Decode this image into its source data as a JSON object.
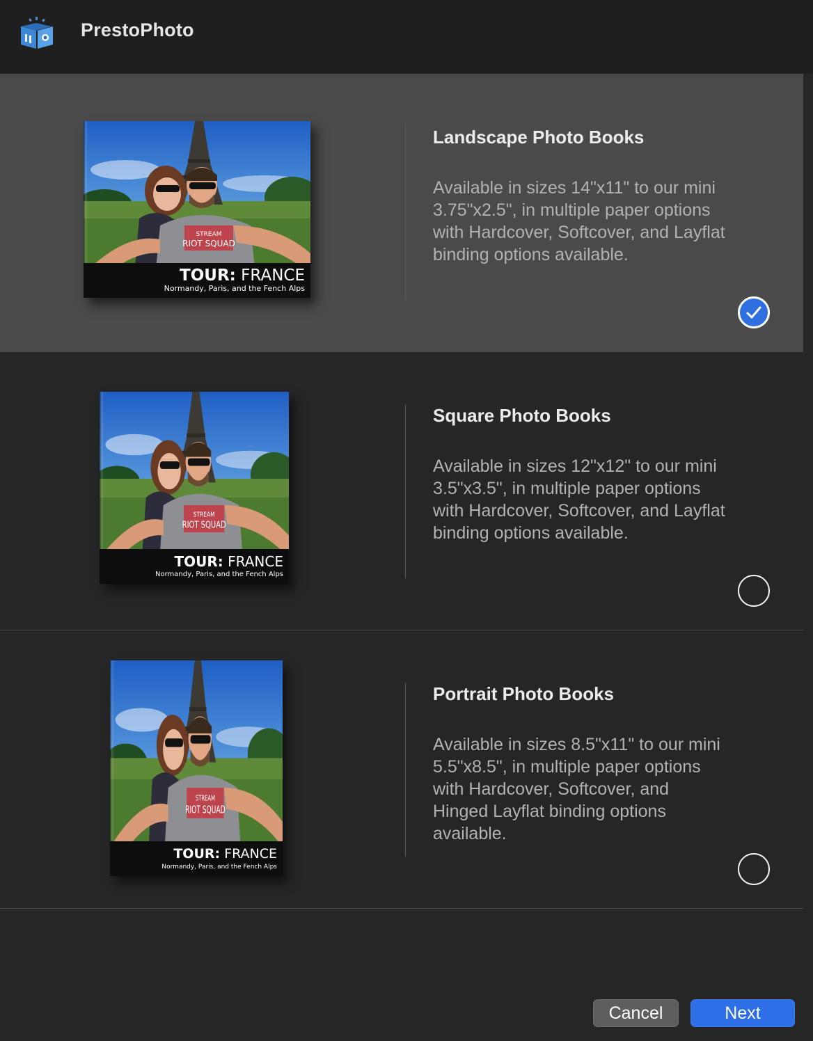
{
  "app": {
    "title": "PrestoPhoto"
  },
  "options": [
    {
      "title": "Landscape Photo Books",
      "description": "Available in sizes 14\"x11\" to our mini 3.75\"x2.5\", in multiple paper options with Hardcover, Softcover, and Layflat binding options available.",
      "selected": true,
      "cover": {
        "title_bold": "TOUR:",
        "title_light": " FRANCE",
        "subtitle": "Normandy, Paris, and the Fench Alps",
        "shirt_text_1": "STREAM",
        "shirt_text_2": "RIOT SQUAD"
      }
    },
    {
      "title": "Square Photo Books",
      "description": "Available in sizes 12\"x12\" to our mini 3.5\"x3.5\", in multiple paper options with Hardcover, Softcover, and Layflat binding options available.",
      "selected": false,
      "cover": {
        "title_bold": "TOUR:",
        "title_light": " FRANCE",
        "subtitle": "Normandy, Paris, and the Fench Alps",
        "shirt_text_1": "STREAM",
        "shirt_text_2": "RIOT SQUAD"
      }
    },
    {
      "title": "Portrait Photo Books",
      "description": "Available in sizes 8.5\"x11\" to our mini 5.5\"x8.5\", in multiple paper options with Hardcover, Softcover, and Hinged Layflat binding options available.",
      "selected": false,
      "cover": {
        "title_bold": "TOUR:",
        "title_light": " FRANCE",
        "subtitle": "Normandy, Paris, and the Fench Alps",
        "shirt_text_1": "STREAM",
        "shirt_text_2": "RIOT SQUAD"
      }
    }
  ],
  "buttons": {
    "cancel": "Cancel",
    "next": "Next"
  },
  "colors": {
    "accent": "#2e6ee6",
    "selected_row": "#4a4a4a",
    "background": "#262626"
  },
  "icons": {
    "logo": "photo-book-logo-icon",
    "check": "checkmark-icon"
  }
}
